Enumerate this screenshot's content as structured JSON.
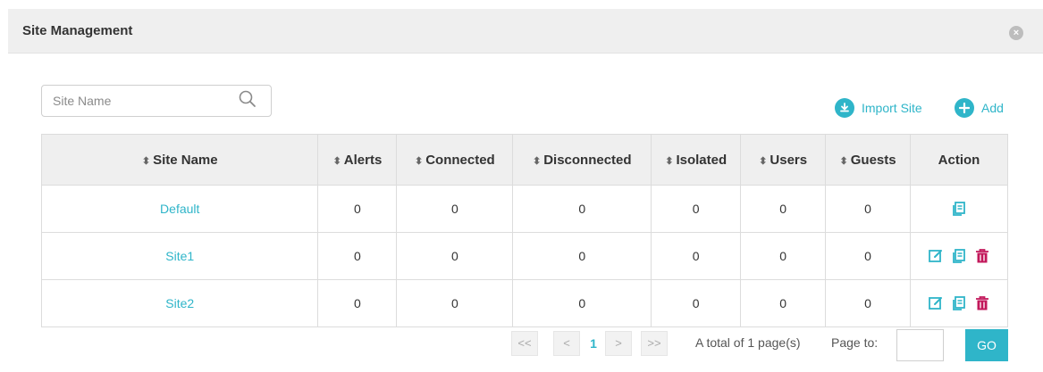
{
  "dialog": {
    "title": "Site Management",
    "close_icon": "close-icon"
  },
  "search": {
    "placeholder": "Site Name",
    "value": ""
  },
  "toolbar": {
    "import_label": "Import Site",
    "add_label": "Add"
  },
  "table": {
    "columns": [
      "Site Name",
      "Alerts",
      "Connected",
      "Disconnected",
      "Isolated",
      "Users",
      "Guests",
      "Action"
    ],
    "rows": [
      {
        "name": "Default",
        "alerts": "0",
        "connected": "0",
        "disconnected": "0",
        "isolated": "0",
        "users": "0",
        "guests": "0",
        "actions": [
          "view"
        ]
      },
      {
        "name": "Site1",
        "alerts": "0",
        "connected": "0",
        "disconnected": "0",
        "isolated": "0",
        "users": "0",
        "guests": "0",
        "actions": [
          "edit",
          "view",
          "delete"
        ]
      },
      {
        "name": "Site2",
        "alerts": "0",
        "connected": "0",
        "disconnected": "0",
        "isolated": "0",
        "users": "0",
        "guests": "0",
        "actions": [
          "edit",
          "view",
          "delete"
        ]
      }
    ]
  },
  "pagination": {
    "first": "<<",
    "prev": "<",
    "current": "1",
    "next": ">",
    "last": ">>",
    "total_text": "A total of 1 page(s)",
    "page_to_label": "Page to:",
    "page_input_value": "",
    "go_label": "GO"
  },
  "colors": {
    "accent": "#2fb5c9",
    "delete": "#c2185b",
    "header_bg": "#efefef"
  }
}
